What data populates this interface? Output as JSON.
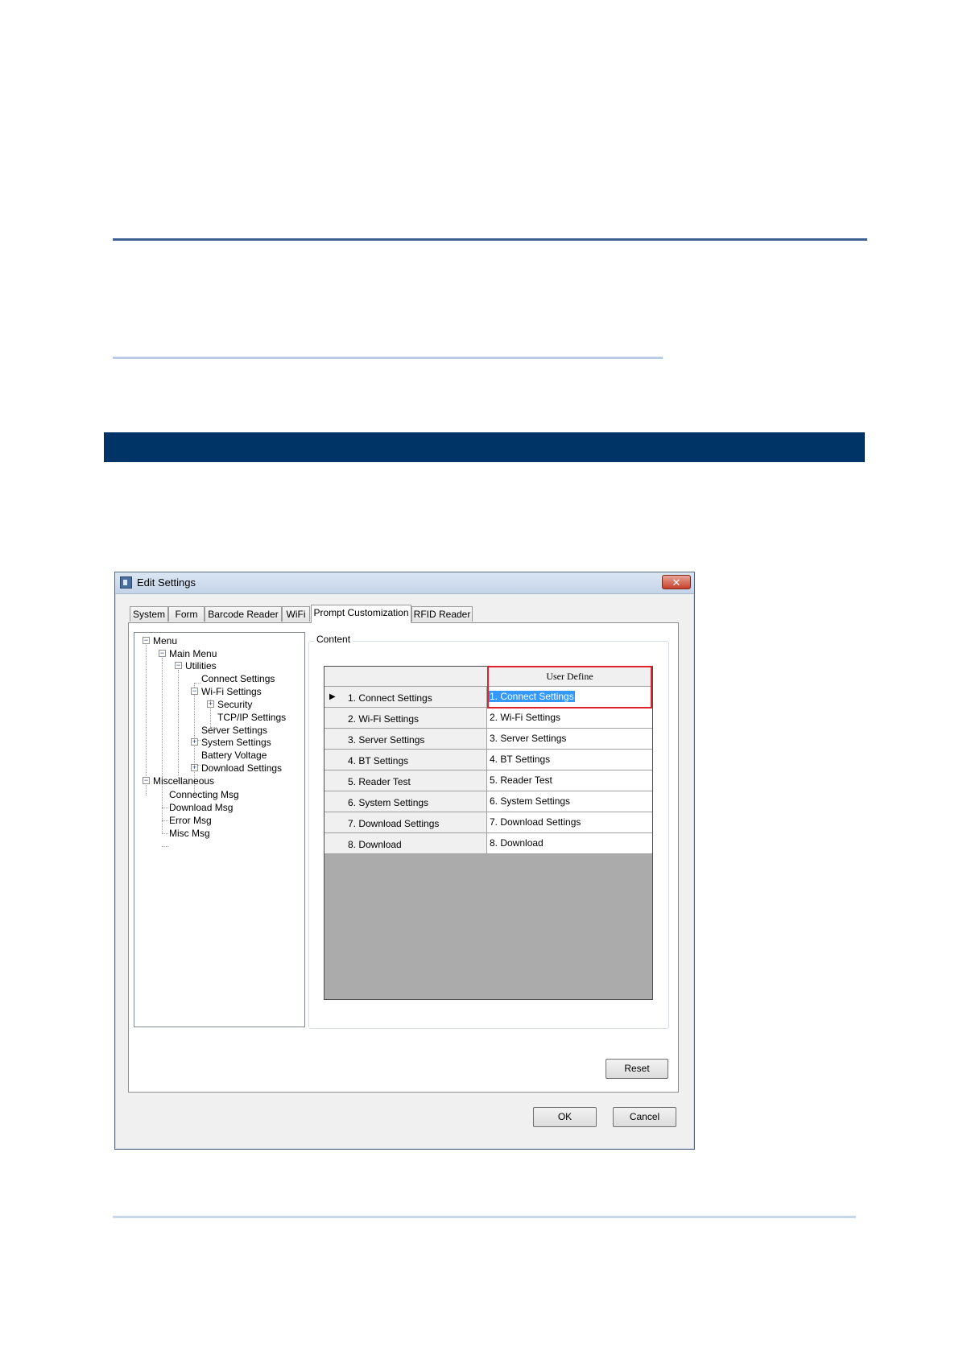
{
  "window": {
    "title": "Edit Settings",
    "close_symbol": "✕"
  },
  "tabs": [
    {
      "label": "System"
    },
    {
      "label": "Form"
    },
    {
      "label": "Barcode Reader"
    },
    {
      "label": "WiFi"
    },
    {
      "label": "Prompt Customization",
      "active": true
    },
    {
      "label": "RFID Reader"
    }
  ],
  "tree": {
    "menu": "Menu",
    "main_menu": "Main Menu",
    "utilities": "Utilities",
    "connect_settings": "Connect Settings",
    "wifi_settings": "Wi-Fi Settings",
    "security": "Security",
    "tcpip_settings": "TCP/IP Settings",
    "server_settings": "Server Settings",
    "system_settings": "System Settings",
    "battery_voltage": "Battery Voltage",
    "download_settings": "Download Settings",
    "miscellaneous": "Miscellaneous",
    "connecting_msg": "Connecting Msg",
    "download_msg": "Download Msg",
    "error_msg": "Error Msg",
    "misc_msg": "Misc Msg",
    "collapse_symbol": "−",
    "expand_symbol": "+"
  },
  "content": {
    "group_label": "Content",
    "column_header": "User Define",
    "current_row_marker": "▶",
    "rows": [
      {
        "label": "1. Connect Settings",
        "value": "1. Connect Settings"
      },
      {
        "label": "2. Wi-Fi Settings",
        "value": "2. Wi-Fi Settings"
      },
      {
        "label": "3. Server Settings",
        "value": "3. Server Settings"
      },
      {
        "label": "4. BT Settings",
        "value": "4. BT Settings"
      },
      {
        "label": "5. Reader Test",
        "value": "5. Reader Test"
      },
      {
        "label": "6. System Settings",
        "value": "6. System Settings"
      },
      {
        "label": "7. Download Settings",
        "value": "7. Download Settings"
      },
      {
        "label": "8. Download",
        "value": "8. Download"
      }
    ]
  },
  "buttons": {
    "reset": "Reset",
    "ok": "OK",
    "cancel": "Cancel"
  },
  "colors": {
    "title_rule": "#3f5f95",
    "section_band": "#003366",
    "highlight_box": "#e0202a",
    "selection": "#3399ff"
  }
}
